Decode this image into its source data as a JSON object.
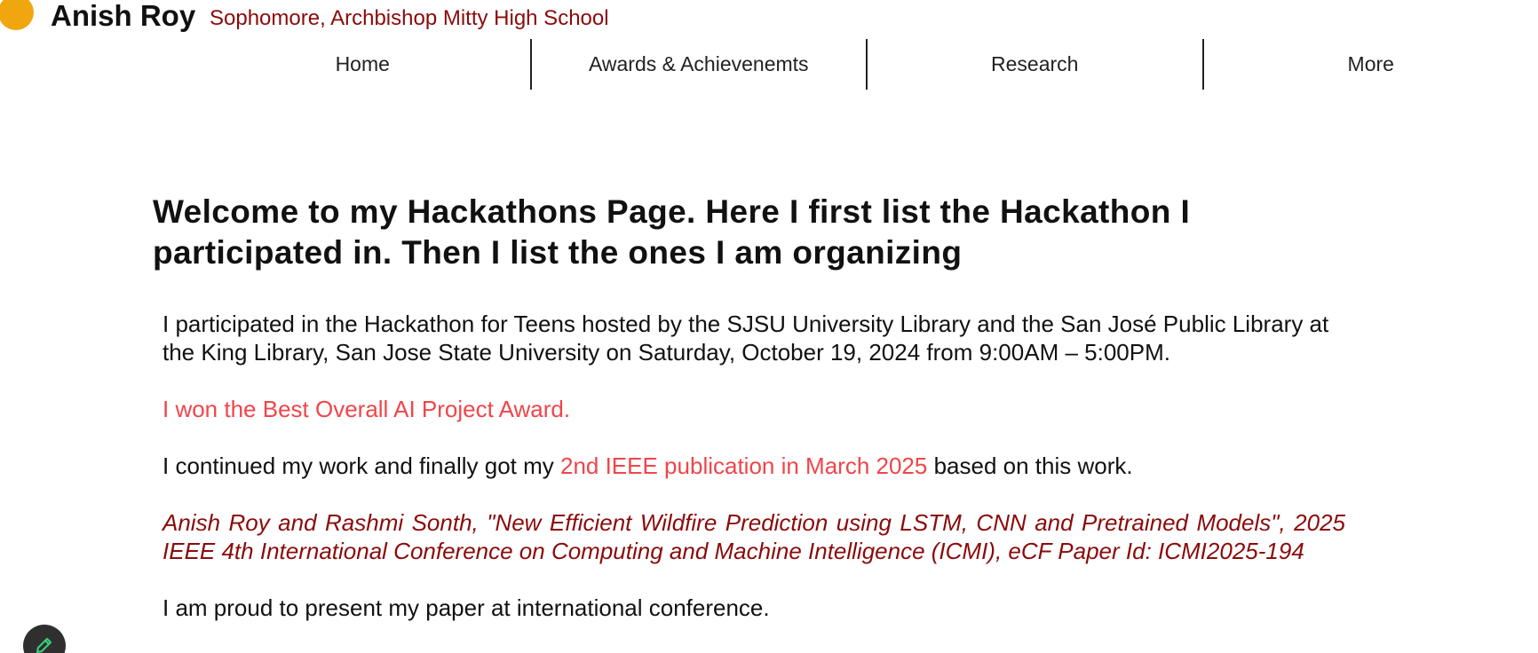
{
  "header": {
    "site_name": "Anish Roy",
    "tagline": "Sophomore, Archbishop Mitty High School",
    "logo_color": "#f0a70f"
  },
  "nav": {
    "items": [
      {
        "label": "Home"
      },
      {
        "label": "Awards & Achievenemts"
      },
      {
        "label": "Research"
      },
      {
        "label": "More"
      }
    ]
  },
  "main": {
    "title": "Welcome to my Hackathons Page. Here I first list the Hackathon I participated in. Then I list the ones I am organizing",
    "paragraph_1": "I participated in the Hackathon for Teens hosted by the SJSU University Library and the San José Public Library at the King Library, San Jose State University on Saturday, October 19, 2024 from 9:00AM – 5:00PM.",
    "award_line": "I won the Best Overall AI Project Award.",
    "continued": {
      "before": "I continued my work and finally got my ",
      "highlight": "2nd IEEE publication in March 2025",
      "after": " based on this work."
    },
    "citation": {
      "author_primary": "Anish Roy",
      "author_connector": " and Rashmi Sonth",
      "rest": ", \"New Efficient Wildfire Prediction using LSTM, CNN and Pretrained Models\", 2025 IEEE 4th International Conference on Computing and Machine Intelligence (ICMI), eCF Paper Id: ICMI2025-194"
    },
    "closing": "I am proud to present my paper at international conference."
  },
  "colors": {
    "accent_red": "#f0454a",
    "dark_red": "#8a0b0b",
    "text": "#111111"
  },
  "icons": {
    "edit_button": "pencil-icon"
  }
}
